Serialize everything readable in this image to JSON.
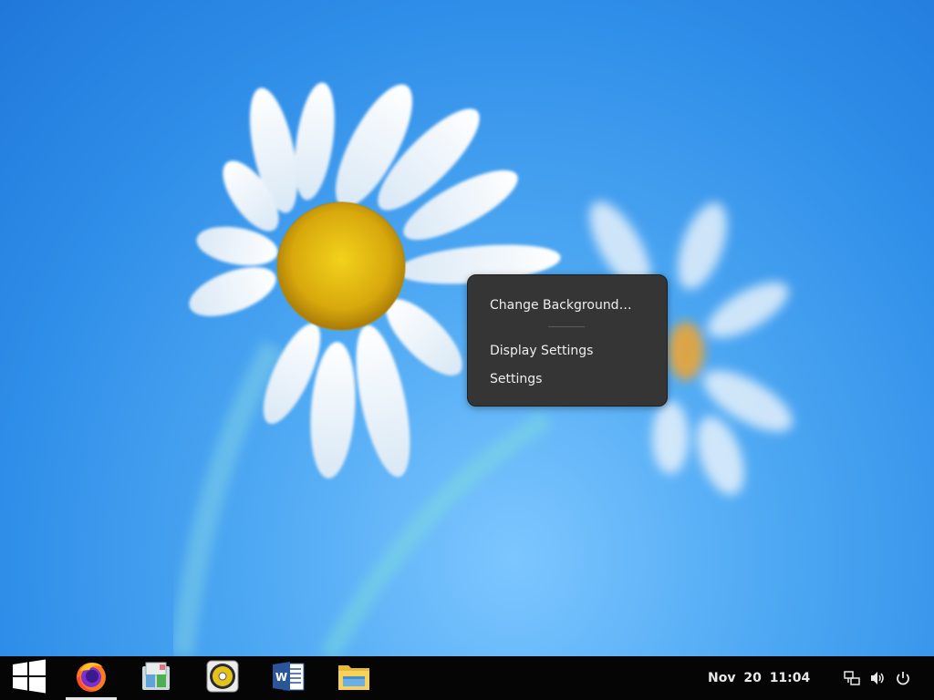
{
  "context_menu": {
    "items": [
      {
        "label": "Change Background…"
      },
      {
        "label": "Display Settings"
      },
      {
        "label": "Settings"
      }
    ]
  },
  "taskbar": {
    "apps": [
      {
        "icon": "windows-logo-icon"
      },
      {
        "icon": "firefox-icon",
        "active": true
      },
      {
        "icon": "mail-app-icon"
      },
      {
        "icon": "music-player-icon"
      },
      {
        "icon": "word-icon"
      },
      {
        "icon": "file-manager-icon"
      }
    ],
    "clock": "Nov 20  11:04",
    "tray": [
      {
        "icon": "network-icon"
      },
      {
        "icon": "volume-icon"
      },
      {
        "icon": "power-icon"
      }
    ]
  },
  "colors": {
    "desktop_blue": "#2f8ee8",
    "menu_bg": "#353535",
    "taskbar_bg": "#050505"
  }
}
